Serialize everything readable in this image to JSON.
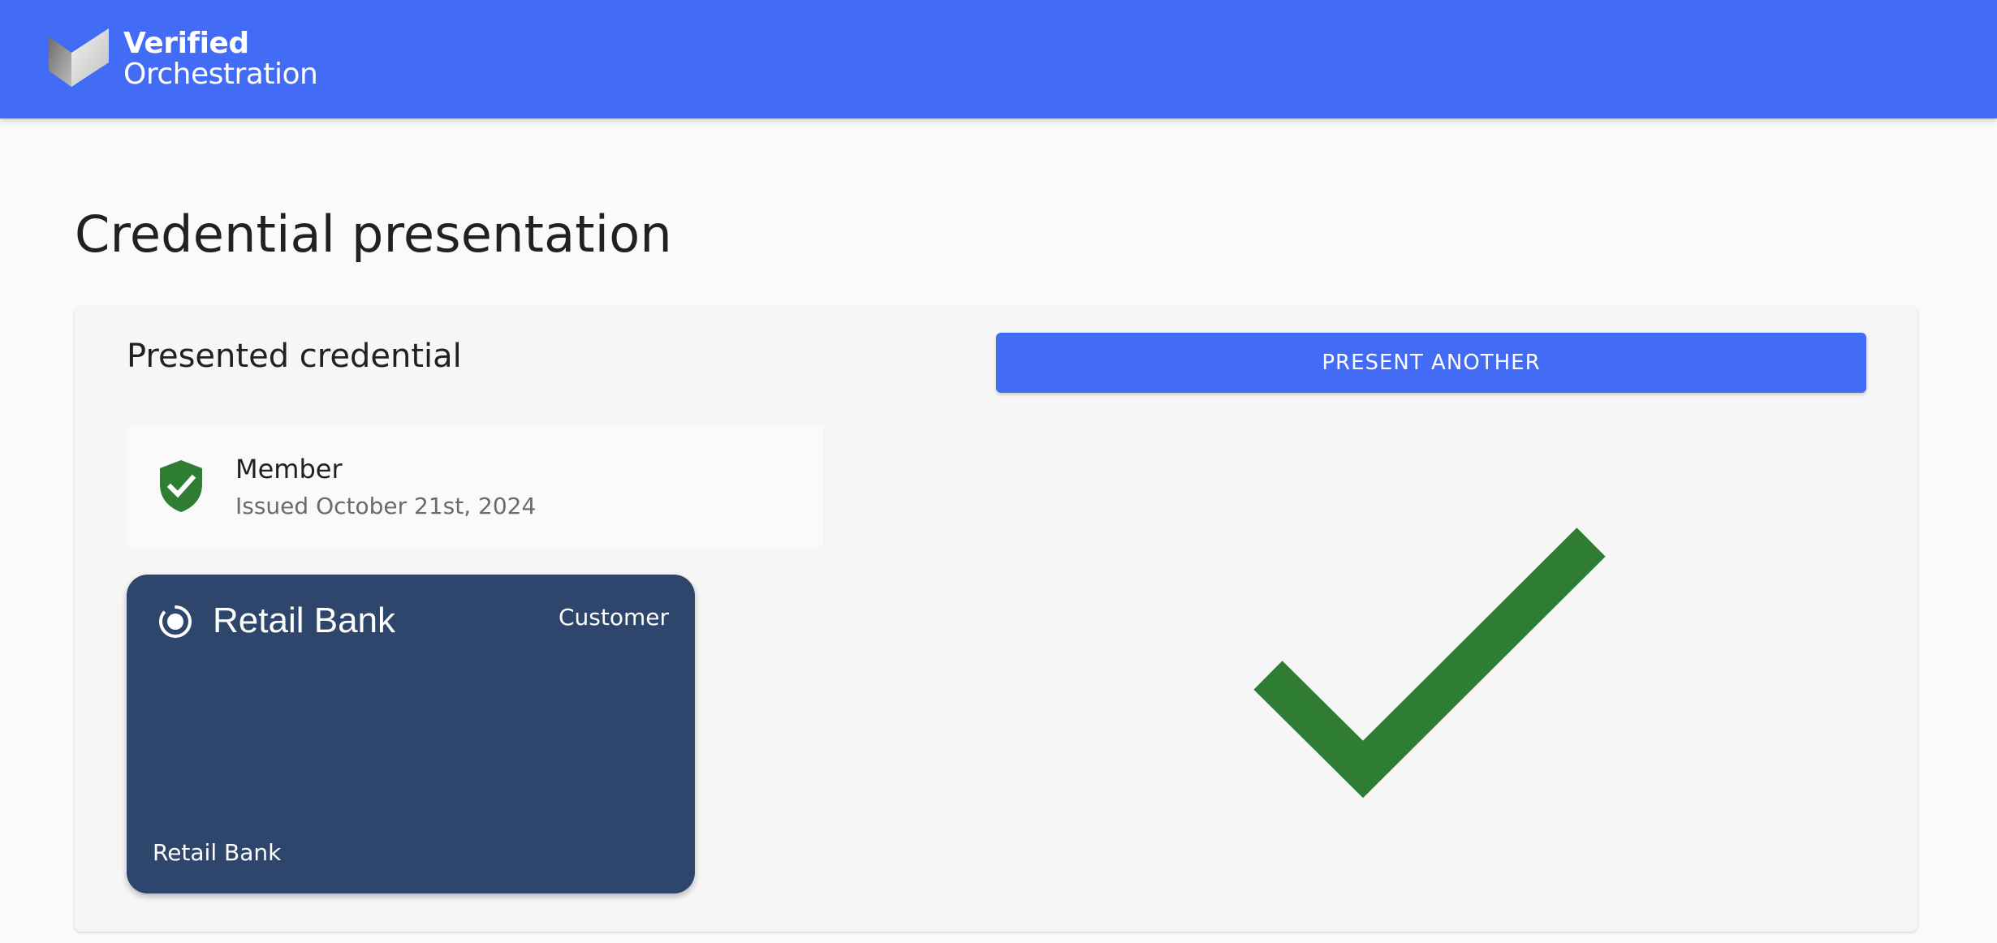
{
  "header": {
    "brand_line1": "Verified",
    "brand_line2": "Orchestration",
    "background_color": "#426cf6"
  },
  "page": {
    "title": "Credential presentation"
  },
  "panel": {
    "title": "Presented credential",
    "present_another_label": "PRESENT ANOTHER"
  },
  "credential": {
    "name": "Member",
    "issued": "Issued October 21st, 2024",
    "status_icon": "shield-check-icon",
    "status_color": "#2e7d32"
  },
  "card": {
    "bank_name": "Retail Bank",
    "type": "Customer",
    "footer": "Retail Bank",
    "background_color": "#2e466c"
  },
  "result": {
    "icon": "checkmark-icon",
    "color": "#2e7d32"
  }
}
